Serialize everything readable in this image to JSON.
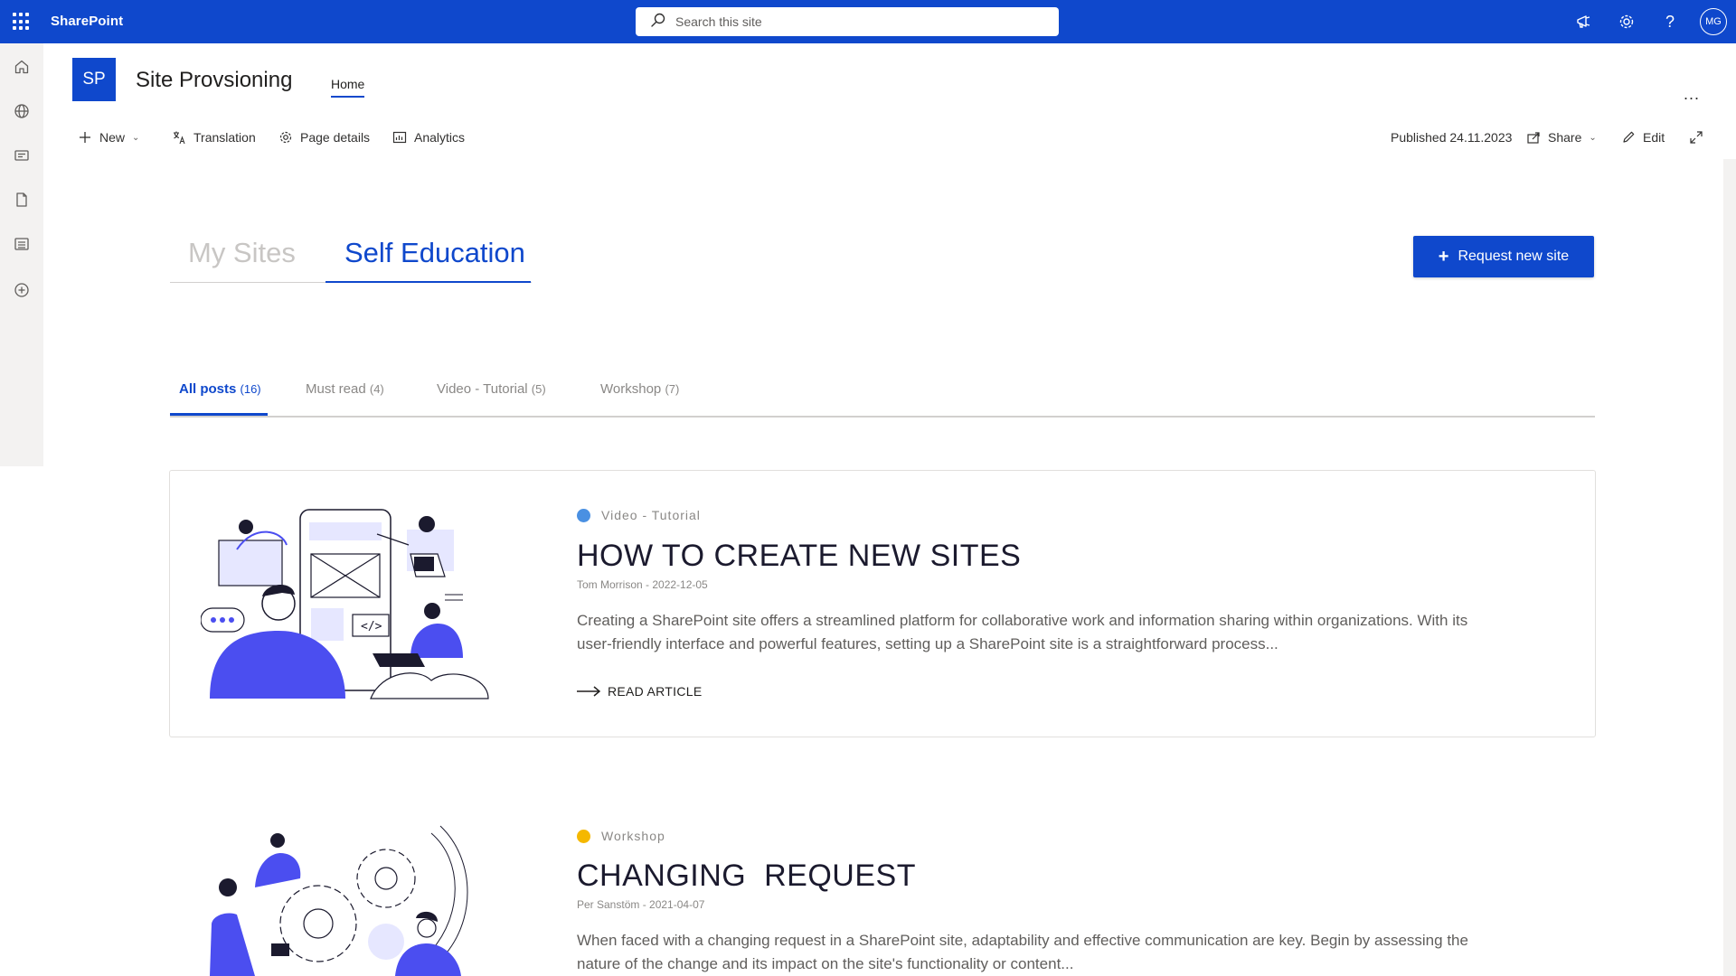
{
  "suite_bar": {
    "app_name": "SharePoint",
    "search_placeholder": "Search this site",
    "avatar_initials": "MG"
  },
  "site": {
    "logo_initials": "SP",
    "title": "Site Provsioning",
    "nav": [
      "Home"
    ],
    "more": "..."
  },
  "command_bar": {
    "new": "New",
    "translation": "Translation",
    "page_details": "Page details",
    "analytics": "Analytics",
    "published": "Published 24.11.2023",
    "share": "Share",
    "edit": "Edit"
  },
  "main_tabs": [
    {
      "label": "My Sites",
      "active": false
    },
    {
      "label": "Self Education",
      "active": true
    }
  ],
  "request_button": {
    "icon": "+",
    "label": "Request new site"
  },
  "filter_tabs": [
    {
      "label": "All posts",
      "count": "(16)",
      "active": true
    },
    {
      "label": "Must read",
      "count": "(4)",
      "active": false
    },
    {
      "label": "Video - Tutorial",
      "count": "(5)",
      "active": false
    },
    {
      "label": "Workshop",
      "count": "(7)",
      "active": false
    }
  ],
  "posts": [
    {
      "category": "Video - Tutorial",
      "category_color": "#4a90e2",
      "title": "HOW TO CREATE NEW SITES",
      "meta": "Tom Morrison - 2022-12-05",
      "excerpt": "Creating a SharePoint site offers a streamlined platform for collaborative work and information sharing within organizations. With its user-friendly interface and powerful features, setting up a SharePoint site is a straightforward process...",
      "link": "READ ARTICLE"
    },
    {
      "category": "Workshop",
      "category_color": "#f5b800",
      "title": "CHANGING  REQUEST",
      "meta": "Per Sanstöm - 2021-04-07",
      "excerpt": "When faced with a changing request in a SharePoint site, adaptability and effective communication are key. Begin by assessing the nature of the change and its impact on the site's functionality or content..."
    }
  ],
  "colors": {
    "brand": "#0f48cc",
    "illustration_accent": "#4b4ef0"
  }
}
